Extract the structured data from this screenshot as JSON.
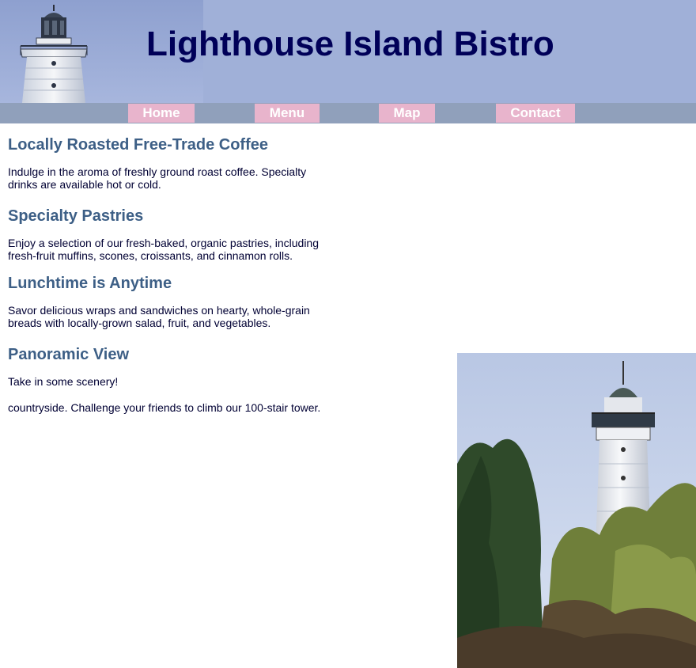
{
  "header": {
    "title": "Lighthouse Island Bistro",
    "background_color": "#a0b0d8",
    "title_color": "#000058"
  },
  "nav": {
    "background_color": "#90a0bb",
    "button_color": "#e8b4cc",
    "items": [
      {
        "label": "Home"
      },
      {
        "label": "Menu"
      },
      {
        "label": "Map"
      },
      {
        "label": "Contact"
      }
    ]
  },
  "main": {
    "heading_color": "#3d5f86",
    "sections": [
      {
        "heading": "Locally Roasted Free-Trade Coffee",
        "text": "Indulge in the aroma of freshly ground roast coffee. Specialty drinks are available hot or cold."
      },
      {
        "heading": "Specialty Pastries",
        "text": "Enjoy a selection of our fresh-baked, organic pastries, including fresh-fruit muffins, scones, croissants, and cinnamon rolls."
      },
      {
        "heading": "Lunchtime is Anytime",
        "text": "Savor delicious wraps and sandwiches on hearty, whole-grain breads with locally-grown salad, fruit, and vegetables."
      },
      {
        "heading": "Panoramic View",
        "text": "Take in some scenery!",
        "text2": "countryside. Challenge your friends to climb our 100-stair tower."
      }
    ]
  }
}
